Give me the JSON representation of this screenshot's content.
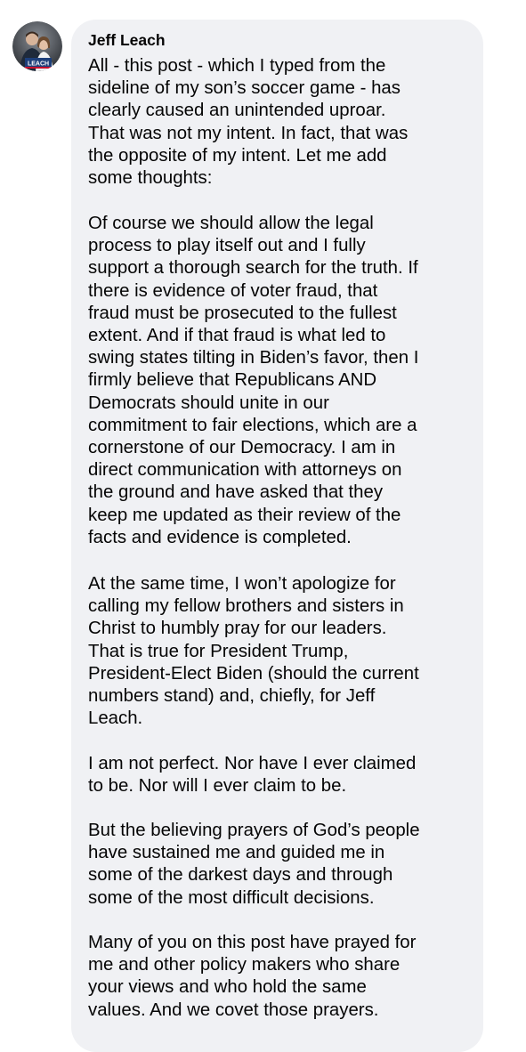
{
  "post": {
    "author": "Jeff Leach",
    "avatar_badge": "LEACH",
    "paragraphs": [
      {
        "lines": [
          "All - this post - which I typed from the",
          "sideline of my son’s soccer game - has",
          "clearly caused an unintended uproar.",
          "That was not my intent. In fact, that was",
          "the opposite of my intent. Let me add",
          "some thoughts:"
        ]
      },
      {
        "lines": [
          "Of course we should allow the legal",
          "process to play itself out and I fully",
          "support a thorough search for the truth. If",
          "there is evidence of voter fraud, that",
          "fraud must be prosecuted to the fullest",
          "extent. And if that fraud is what led to",
          "swing states tilting in Biden’s favor, then I",
          "firmly believe that Republicans AND",
          "Democrats should unite in our",
          "commitment to fair elections, which are a",
          "cornerstone of our Democracy. I am in",
          "direct communication with attorneys on",
          "the ground and have asked that they",
          "keep me updated as their review of the",
          "facts and evidence is completed."
        ]
      },
      {
        "lines": [
          "At the same time, I won’t apologize for",
          "calling my fellow brothers and sisters in",
          "Christ to humbly pray for our leaders.",
          "That is true for President Trump,",
          "President-Elect Biden (should the current",
          "numbers stand) and, chiefly, for Jeff",
          "Leach."
        ]
      },
      {
        "lines": [
          "I am not perfect. Nor have I ever claimed",
          "to be. Nor will I ever claim to be."
        ]
      },
      {
        "lines": [
          "But the believing prayers of God’s people",
          "have sustained me and guided me in",
          "some of the darkest days and through",
          "some of the most difficult decisions."
        ]
      },
      {
        "lines": [
          "Many of you on this post have prayed for",
          "me and other policy makers who share",
          "your views and who hold the same",
          "values. And we covet those prayers."
        ]
      }
    ]
  }
}
